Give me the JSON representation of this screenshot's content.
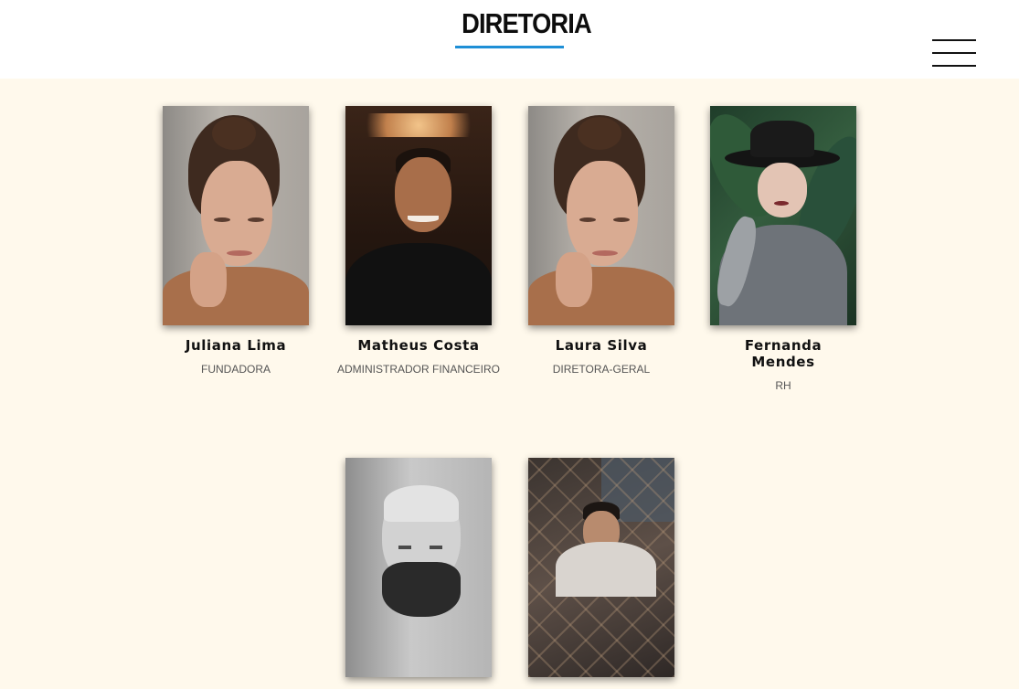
{
  "header": {
    "title": "DIRETORIA",
    "accent_color": "#1e8fd6",
    "menu_icon": "hamburger-menu-icon"
  },
  "team": [
    {
      "name": "Juliana Lima",
      "role": "FUNDADORA"
    },
    {
      "name": "Matheus Costa",
      "role": "ADMINISTRADOR FINANCEIRO"
    },
    {
      "name": "Laura Silva",
      "role": "DIRETORA-GERAL"
    },
    {
      "name": "Fernanda Mendes",
      "role": "RH"
    },
    {
      "name": "",
      "role": ""
    },
    {
      "name": "",
      "role": ""
    }
  ],
  "colors": {
    "page_background": "#fff9ec",
    "header_background": "#ffffff"
  }
}
